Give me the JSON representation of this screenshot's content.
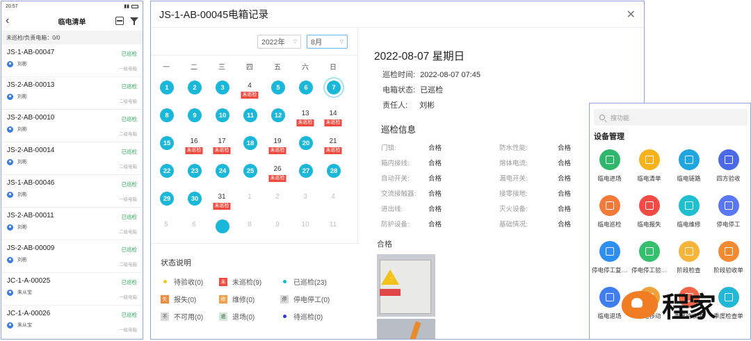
{
  "phone": {
    "time": "20:57",
    "title": "临电清单",
    "summary": "未巡检/负责电箱：0/0",
    "items": [
      {
        "code": "JS-1-AB-00047",
        "status": "已巡检",
        "person": "刘彬",
        "level": "一级电箱"
      },
      {
        "code": "JS-2-AB-00013",
        "status": "已巡检",
        "person": "刘彬",
        "level": "二级电箱"
      },
      {
        "code": "JS-2-AB-00010",
        "status": "已巡检",
        "person": "刘彬",
        "level": "二级电箱"
      },
      {
        "code": "JS-2-AB-00014",
        "status": "已巡检",
        "person": "刘彬",
        "level": "二级电箱"
      },
      {
        "code": "JS-1-AB-00046",
        "status": "已巡检",
        "person": "刘彬",
        "level": "一级电箱"
      },
      {
        "code": "JS-2-AB-00011",
        "status": "已巡检",
        "person": "刘彬",
        "level": "二级电箱"
      },
      {
        "code": "JS-2-AB-00009",
        "status": "已巡检",
        "person": "刘彬",
        "level": "二级电箱"
      },
      {
        "code": "JC-1-A-00025",
        "status": "已巡检",
        "person": "朱从宝",
        "level": "一级电箱"
      },
      {
        "code": "JC-1-A-00026",
        "status": "已巡检",
        "person": "朱从宝",
        "level": "一级电箱"
      }
    ]
  },
  "dialog": {
    "title": "JS-1-AB-00045电箱记录",
    "year": "2022年",
    "month": "8月",
    "weekdays": [
      "一",
      "二",
      "三",
      "四",
      "五",
      "六",
      "日"
    ],
    "tag_label": "未巡检",
    "days": [
      {
        "d": "1",
        "s": "done"
      },
      {
        "d": "2",
        "s": "done"
      },
      {
        "d": "3",
        "s": "done"
      },
      {
        "d": "4",
        "s": "missed"
      },
      {
        "d": "5",
        "s": "done"
      },
      {
        "d": "6",
        "s": "done"
      },
      {
        "d": "7",
        "s": "today"
      },
      {
        "d": "8",
        "s": "done"
      },
      {
        "d": "9",
        "s": "done"
      },
      {
        "d": "10",
        "s": "done"
      },
      {
        "d": "11",
        "s": "done"
      },
      {
        "d": "12",
        "s": "done"
      },
      {
        "d": "13",
        "s": "missed"
      },
      {
        "d": "14",
        "s": "missed"
      },
      {
        "d": "15",
        "s": "done"
      },
      {
        "d": "16",
        "s": "missed"
      },
      {
        "d": "17",
        "s": "missed"
      },
      {
        "d": "18",
        "s": "done"
      },
      {
        "d": "19",
        "s": "missed"
      },
      {
        "d": "20",
        "s": "done"
      },
      {
        "d": "21",
        "s": "missed"
      },
      {
        "d": "22",
        "s": "done"
      },
      {
        "d": "23",
        "s": "done"
      },
      {
        "d": "24",
        "s": "done"
      },
      {
        "d": "25",
        "s": "done"
      },
      {
        "d": "26",
        "s": "missed"
      },
      {
        "d": "27",
        "s": "done"
      },
      {
        "d": "28",
        "s": "done"
      },
      {
        "d": "29",
        "s": "done"
      },
      {
        "d": "30",
        "s": "done"
      },
      {
        "d": "31",
        "s": "missed"
      },
      {
        "d": "1",
        "s": "other"
      },
      {
        "d": "2",
        "s": "other"
      },
      {
        "d": "3",
        "s": "other"
      },
      {
        "d": "4",
        "s": "other"
      },
      {
        "d": "5",
        "s": "other"
      },
      {
        "d": "6",
        "s": "other"
      },
      {
        "d": "",
        "s": "dot"
      },
      {
        "d": "8",
        "s": "other"
      },
      {
        "d": "9",
        "s": "other"
      },
      {
        "d": "10",
        "s": "other"
      },
      {
        "d": "11",
        "s": "other"
      }
    ],
    "legend_title": "状态说明",
    "legend": [
      {
        "label": "待验收(0)",
        "kind": "dot",
        "color": "#f5c518",
        "sym": ""
      },
      {
        "label": "未巡检(9)",
        "kind": "box",
        "color": "#ef4a3e",
        "sym": "未"
      },
      {
        "label": "已巡检(23)",
        "kind": "dot",
        "color": "#1bb7d8",
        "sym": ""
      },
      {
        "label": "报失(0)",
        "kind": "box",
        "color": "#f08a3c",
        "sym": "失"
      },
      {
        "label": "维修(0)",
        "kind": "box",
        "color": "#f0a24a",
        "sym": "修"
      },
      {
        "label": "停电停工(0)",
        "kind": "box",
        "color": "#d9d9d9",
        "sym": "停"
      },
      {
        "label": "不可用(0)",
        "kind": "box",
        "color": "#d9d9d9",
        "sym": "不"
      },
      {
        "label": "退场(0)",
        "kind": "box",
        "color": "#cfe9d3",
        "sym": "退"
      },
      {
        "label": "待巡检(0)",
        "kind": "dot",
        "color": "#2d3ed8",
        "sym": ""
      }
    ],
    "detail": {
      "date": "2022-08-07 星期日",
      "time_label": "巡检时间:",
      "time_value": "2022-08-07 07:45",
      "status_label": "电箱状态:",
      "status_value": "已巡检",
      "owner_label": "责任人:",
      "owner_value": "刘彬",
      "section_title": "巡检信息",
      "checks": [
        {
          "k": "门锁:",
          "v": "合格"
        },
        {
          "k": "防水性能:",
          "v": "合格"
        },
        {
          "k": "箱内接线:",
          "v": "合格"
        },
        {
          "k": "熔体电流:",
          "v": "合格"
        },
        {
          "k": "自动开关:",
          "v": "合格"
        },
        {
          "k": "漏电开关:",
          "v": "合格"
        },
        {
          "k": "交流接触器:",
          "v": "合格"
        },
        {
          "k": "接零接地:",
          "v": "合格"
        },
        {
          "k": "进出线:",
          "v": "合格"
        },
        {
          "k": "灭火设备:",
          "v": "合格"
        },
        {
          "k": "防护设备:",
          "v": "合格"
        },
        {
          "k": "基础情况:",
          "v": "合格"
        }
      ],
      "photo_label": "合格"
    }
  },
  "menu": {
    "search_placeholder": "搜功能",
    "section_title": "设备管理",
    "items": [
      {
        "label": "临电进场",
        "color": "#2fb86b"
      },
      {
        "label": "临电清单",
        "color": "#f5b21c"
      },
      {
        "label": "临电链路",
        "color": "#1fa6e0"
      },
      {
        "label": "四方验收",
        "color": "#4b68e6"
      },
      {
        "label": "临电巡检",
        "color": "#f47a3a"
      },
      {
        "label": "临电报失",
        "color": "#f24b45"
      },
      {
        "label": "临电维修",
        "color": "#1ebfd1"
      },
      {
        "label": "停电停工",
        "color": "#5a76f0"
      },
      {
        "label": "停电停工复…",
        "color": "#2f8ff0"
      },
      {
        "label": "停电停工验…",
        "color": "#34c06f"
      },
      {
        "label": "阶段检查",
        "color": "#f6b43a"
      },
      {
        "label": "阶段验收单",
        "color": "#f28a32"
      },
      {
        "label": "临电退场",
        "color": "#3f7ef0"
      },
      {
        "label": "临电移动",
        "color": "#f0a23a"
      },
      {
        "label": "季度验收单",
        "color": "#f4664a"
      },
      {
        "label": "季度检查单",
        "color": "#22b8d6"
      }
    ]
  },
  "watermark": {
    "text": "程家"
  }
}
